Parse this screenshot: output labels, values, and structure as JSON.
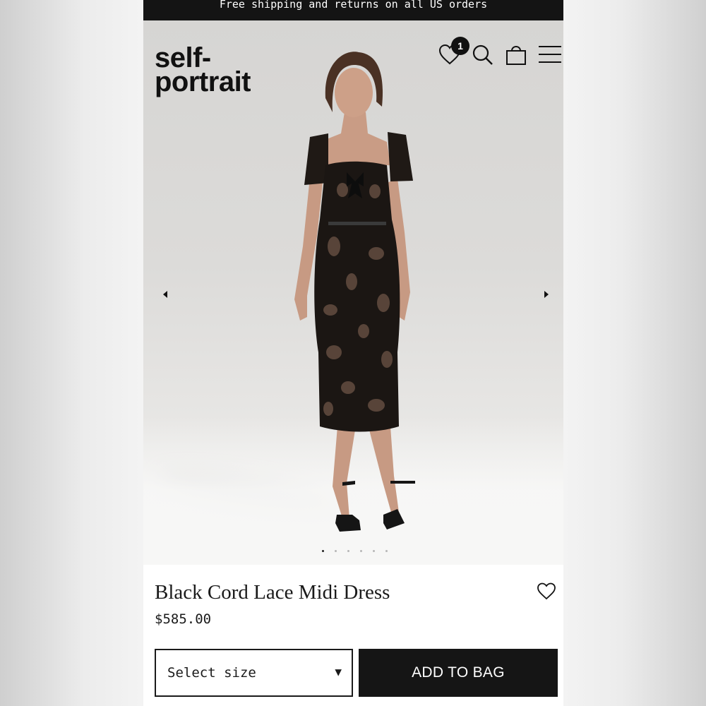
{
  "promo_bar": {
    "text": "Free shipping and returns on all US orders"
  },
  "header": {
    "logo_line1": "self-",
    "logo_line2": "portrait",
    "wishlist_count": "1",
    "icons": [
      "heart-icon",
      "search-icon",
      "bag-icon",
      "menu-icon"
    ]
  },
  "gallery": {
    "prev_icon": "caret-left-icon",
    "next_icon": "caret-right-icon",
    "slide_count": 6,
    "active_slide": 1
  },
  "product": {
    "name": "Black Cord Lace Midi Dress",
    "price": "$585.00"
  },
  "actions": {
    "size_label": "Select size",
    "caret": "▼",
    "add_to_bag": "ADD TO BAG"
  },
  "colors": {
    "primary": "#151515",
    "background": "#ffffff",
    "hero_background": "#dcdbd9"
  }
}
